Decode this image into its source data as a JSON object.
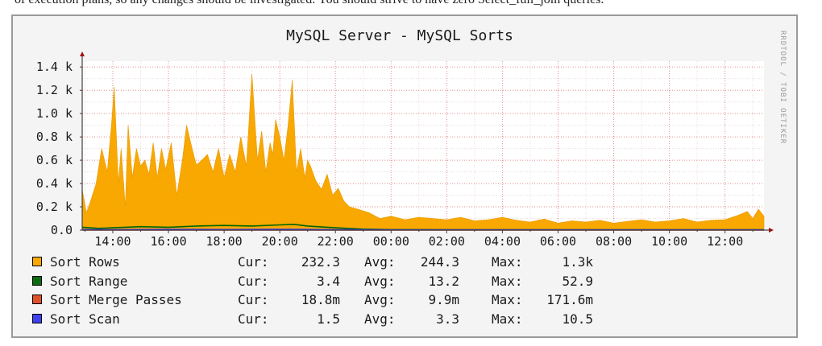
{
  "page": {
    "top_text": "of execution plans, so any changes should be investigated. You should strive to have zero Select_full_join queries."
  },
  "chart_data": {
    "type": "area",
    "title": "MySQL Server - MySQL Sorts",
    "credit": "RRDTOOL / TOBI OETIKER",
    "x_tick_labels": [
      "14:00",
      "16:00",
      "18:00",
      "20:00",
      "22:00",
      "00:00",
      "02:00",
      "04:00",
      "06:00",
      "08:00",
      "10:00",
      "12:00"
    ],
    "x_start_hour": 12.9,
    "x_end_hour": 37.4,
    "y_tick_labels": [
      "0.0",
      "0.2 k",
      "0.4 k",
      "0.6 k",
      "0.8 k",
      "1.0 k",
      "1.2 k",
      "1.4 k"
    ],
    "ylim": [
      0,
      1450
    ],
    "grid": true,
    "series": [
      {
        "name": "Sort Rows",
        "color": "#f8a800",
        "fill": true,
        "x": [
          12.9,
          13.05,
          13.2,
          13.4,
          13.6,
          13.8,
          13.95,
          14.05,
          14.2,
          14.3,
          14.45,
          14.55,
          14.7,
          14.85,
          15.0,
          15.15,
          15.3,
          15.45,
          15.6,
          15.75,
          15.9,
          16.1,
          16.3,
          16.5,
          16.65,
          16.85,
          17.0,
          17.2,
          17.4,
          17.6,
          17.8,
          18.0,
          18.2,
          18.4,
          18.6,
          18.8,
          19.0,
          19.2,
          19.35,
          19.5,
          19.65,
          19.75,
          19.85,
          20.0,
          20.15,
          20.3,
          20.45,
          20.6,
          20.75,
          20.9,
          21.0,
          21.1,
          21.3,
          21.5,
          21.7,
          21.9,
          22.1,
          22.3,
          22.5,
          22.8,
          23.2,
          23.6,
          24.0,
          24.5,
          25.0,
          25.5,
          26.0,
          26.5,
          27.0,
          27.5,
          28.0,
          28.5,
          29.0,
          29.5,
          30.0,
          30.5,
          31.0,
          31.5,
          32.0,
          32.5,
          33.0,
          33.5,
          34.0,
          34.5,
          35.0,
          35.5,
          36.0,
          36.5,
          36.8,
          37.0,
          37.2,
          37.4
        ],
        "y": [
          350,
          150,
          250,
          400,
          700,
          500,
          900,
          1230,
          400,
          700,
          200,
          900,
          450,
          700,
          550,
          600,
          480,
          750,
          450,
          700,
          520,
          750,
          300,
          600,
          900,
          700,
          560,
          600,
          650,
          500,
          700,
          450,
          650,
          500,
          800,
          550,
          1340,
          600,
          850,
          500,
          750,
          650,
          950,
          800,
          600,
          900,
          1290,
          500,
          700,
          450,
          600,
          550,
          420,
          350,
          480,
          300,
          360,
          250,
          200,
          180,
          150,
          100,
          120,
          90,
          110,
          100,
          90,
          110,
          80,
          90,
          110,
          85,
          70,
          95,
          60,
          80,
          70,
          85,
          60,
          75,
          90,
          70,
          80,
          100,
          70,
          85,
          90,
          130,
          160,
          100,
          180,
          120
        ]
      },
      {
        "name": "Sort Range",
        "color": "#006400",
        "fill": false,
        "x": [
          12.9,
          13.5,
          14.0,
          15.0,
          16.0,
          17.0,
          18.0,
          19.0,
          20.0,
          20.5,
          21.0,
          22.0,
          23.0,
          24.0,
          26.0,
          30.0,
          34.0,
          37.4
        ],
        "y": [
          25,
          15,
          20,
          30,
          25,
          35,
          40,
          35,
          45,
          50,
          35,
          20,
          8,
          4,
          3,
          3,
          3,
          3
        ]
      },
      {
        "name": "Sort Merge Passes",
        "color": "#e04020",
        "fill": false,
        "x": [
          12.9,
          37.4
        ],
        "y": [
          0.02,
          0.02
        ]
      },
      {
        "name": "Sort Scan",
        "color": "#3030ff",
        "fill": false,
        "x": [
          12.9,
          14.0,
          16.0,
          18.0,
          20.0,
          22.0,
          24.0,
          28.0,
          32.0,
          37.4
        ],
        "y": [
          5,
          4,
          6,
          5,
          7,
          4,
          2,
          2,
          2,
          2
        ]
      }
    ],
    "legend": [
      {
        "name": "Sort Rows",
        "color": "#f8a800",
        "cur_label": "Cur:",
        "cur": "232.3",
        "avg_label": "Avg:",
        "avg": "244.3",
        "max_label": "Max:",
        "max": "1.3k"
      },
      {
        "name": "Sort Range",
        "color": "#0c6a14",
        "cur_label": "Cur:",
        "cur": "3.4",
        "avg_label": "Avg:",
        "avg": "13.2",
        "max_label": "Max:",
        "max": "52.9"
      },
      {
        "name": "Sort Merge Passes",
        "color": "#e0502a",
        "cur_label": "Cur:",
        "cur": "18.8m",
        "avg_label": "Avg:",
        "avg": "9.9m",
        "max_label": "Max:",
        "max": "171.6m"
      },
      {
        "name": "Sort Scan",
        "color": "#4040f0",
        "cur_label": "Cur:",
        "cur": "1.5",
        "avg_label": "Avg:",
        "avg": "3.3",
        "max_label": "Max:",
        "max": "10.5"
      }
    ]
  }
}
